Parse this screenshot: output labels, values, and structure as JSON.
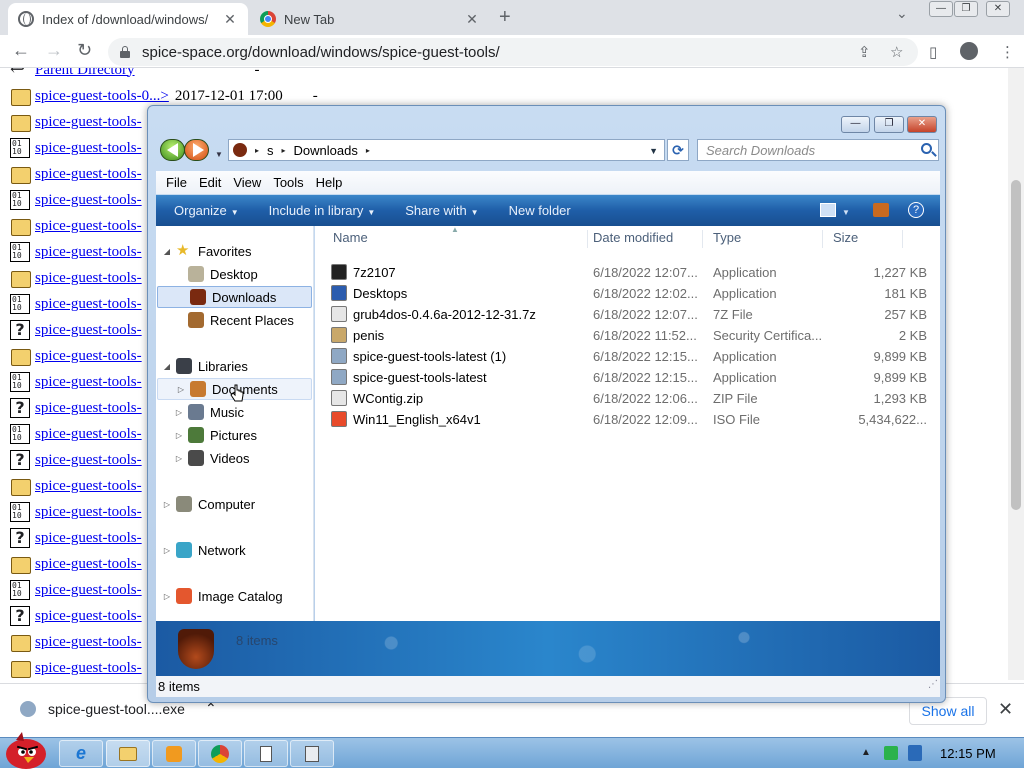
{
  "browser": {
    "tabs": [
      {
        "title": "Index of /download/windows/",
        "close": "✕"
      },
      {
        "title": "New Tab",
        "close": "✕"
      }
    ],
    "new_tab_glyph": "+",
    "tab_search_glyph": "⌄",
    "window_controls": [
      "—",
      "❐",
      "✕"
    ],
    "nav": {
      "back": "←",
      "forward": "→",
      "reload": "↻"
    },
    "url": "spice-space.org/download/windows/spice-guest-tools/",
    "toolbar_icons": [
      "share-icon",
      "star-icon",
      "side-panel-icon",
      "profile-icon",
      "menu-icon"
    ]
  },
  "listing": {
    "parent": "Parent Directory",
    "parent_meta": "-",
    "first_link": "spice-guest-tools-0...>",
    "first_meta": "2017-12-01 17:00",
    "first_size": "-",
    "repeat_link": "spice-guest-tools-",
    "row_icons": [
      "folder",
      "bin",
      "folder",
      "bin",
      "folder",
      "bin",
      "folder",
      "bin",
      "unk",
      "folder",
      "bin",
      "unk",
      "bin",
      "unk",
      "folder",
      "bin",
      "unk",
      "folder",
      "bin",
      "unk",
      "folder",
      "folder",
      "bin"
    ]
  },
  "downloads_bar": {
    "file": "spice-guest-tool....exe",
    "chevron": "⌃",
    "show_all": "Show all",
    "close": "✕"
  },
  "taskbar": {
    "time": "12:15 PM",
    "tray_up": "▲"
  },
  "explorer": {
    "caption": {
      "min": "—",
      "max": "❐",
      "close": "✕"
    },
    "address": {
      "root": "s",
      "folder": "Downloads",
      "sep": "▸"
    },
    "search_placeholder": "Search Downloads",
    "menu": [
      "File",
      "Edit",
      "View",
      "Tools",
      "Help"
    ],
    "commands": [
      "Organize",
      "Include in library",
      "Share with",
      "New folder"
    ],
    "nav": [
      {
        "label": "Favorites",
        "icon": "star-icon",
        "level": 0,
        "twisty": "◢"
      },
      {
        "label": "Desktop",
        "icon": "desktop-icon",
        "level": 1,
        "twisty": ""
      },
      {
        "label": "Downloads",
        "icon": "downloads-icon",
        "level": 1,
        "twisty": "",
        "selected": true
      },
      {
        "label": "Recent Places",
        "icon": "recent-places-icon",
        "level": 1,
        "twisty": ""
      },
      {
        "label": "Libraries",
        "icon": "libraries-icon",
        "level": 0,
        "twisty": "◢"
      },
      {
        "label": "Documents",
        "icon": "documents-icon",
        "level": 1,
        "twisty": "▷",
        "hover": true
      },
      {
        "label": "Music",
        "icon": "music-icon",
        "level": 1,
        "twisty": "▷"
      },
      {
        "label": "Pictures",
        "icon": "pictures-icon",
        "level": 1,
        "twisty": "▷"
      },
      {
        "label": "Videos",
        "icon": "videos-icon",
        "level": 1,
        "twisty": "▷"
      },
      {
        "label": "Computer",
        "icon": "computer-icon",
        "level": 0,
        "twisty": "▷"
      },
      {
        "label": "Network",
        "icon": "network-icon",
        "level": 0,
        "twisty": "▷"
      },
      {
        "label": "Image Catalog",
        "icon": "image-catalog-icon",
        "level": 0,
        "twisty": "▷"
      }
    ],
    "columns": [
      "Name",
      "Date modified",
      "Type",
      "Size"
    ],
    "sort_caret": "▲",
    "files": [
      {
        "name": "7z2107",
        "date": "6/18/2022 12:07...",
        "type": "Application",
        "size": "1,227 KB",
        "icon": "7zip-icon",
        "color": "#222222"
      },
      {
        "name": "Desktops",
        "date": "6/18/2022 12:02...",
        "type": "Application",
        "size": "181 KB",
        "icon": "desktops-app-icon",
        "color": "#2b5cae"
      },
      {
        "name": "grub4dos-0.4.6a-2012-12-31.7z",
        "date": "6/18/2022 12:07...",
        "type": "7Z File",
        "size": "257 KB",
        "icon": "archive-file-icon",
        "color": "#e6e6e6"
      },
      {
        "name": "penis",
        "date": "6/18/2022 11:52...",
        "type": "Security Certifica...",
        "size": "2 KB",
        "icon": "certificate-icon",
        "color": "#c9a86a"
      },
      {
        "name": "spice-guest-tools-latest (1)",
        "date": "6/18/2022 12:15...",
        "type": "Application",
        "size": "9,899 KB",
        "icon": "installer-icon",
        "color": "#8fa8c4"
      },
      {
        "name": "spice-guest-tools-latest",
        "date": "6/18/2022 12:15...",
        "type": "Application",
        "size": "9,899 KB",
        "icon": "installer-icon",
        "color": "#8fa8c4"
      },
      {
        "name": "WContig.zip",
        "date": "6/18/2022 12:06...",
        "type": "ZIP File",
        "size": "1,293 KB",
        "icon": "zip-file-icon",
        "color": "#e6e6e6"
      },
      {
        "name": "Win11_English_x64v1",
        "date": "6/18/2022 12:09...",
        "type": "ISO File",
        "size": "5,434,622...",
        "icon": "iso-file-icon",
        "color": "#e84a2a"
      }
    ],
    "detail_count": "8 items",
    "status": "8 items"
  },
  "colors": {
    "link": "#0000ee",
    "explorer_cmdbar": "#1f5ea8",
    "selection": "#dbe7f8"
  }
}
